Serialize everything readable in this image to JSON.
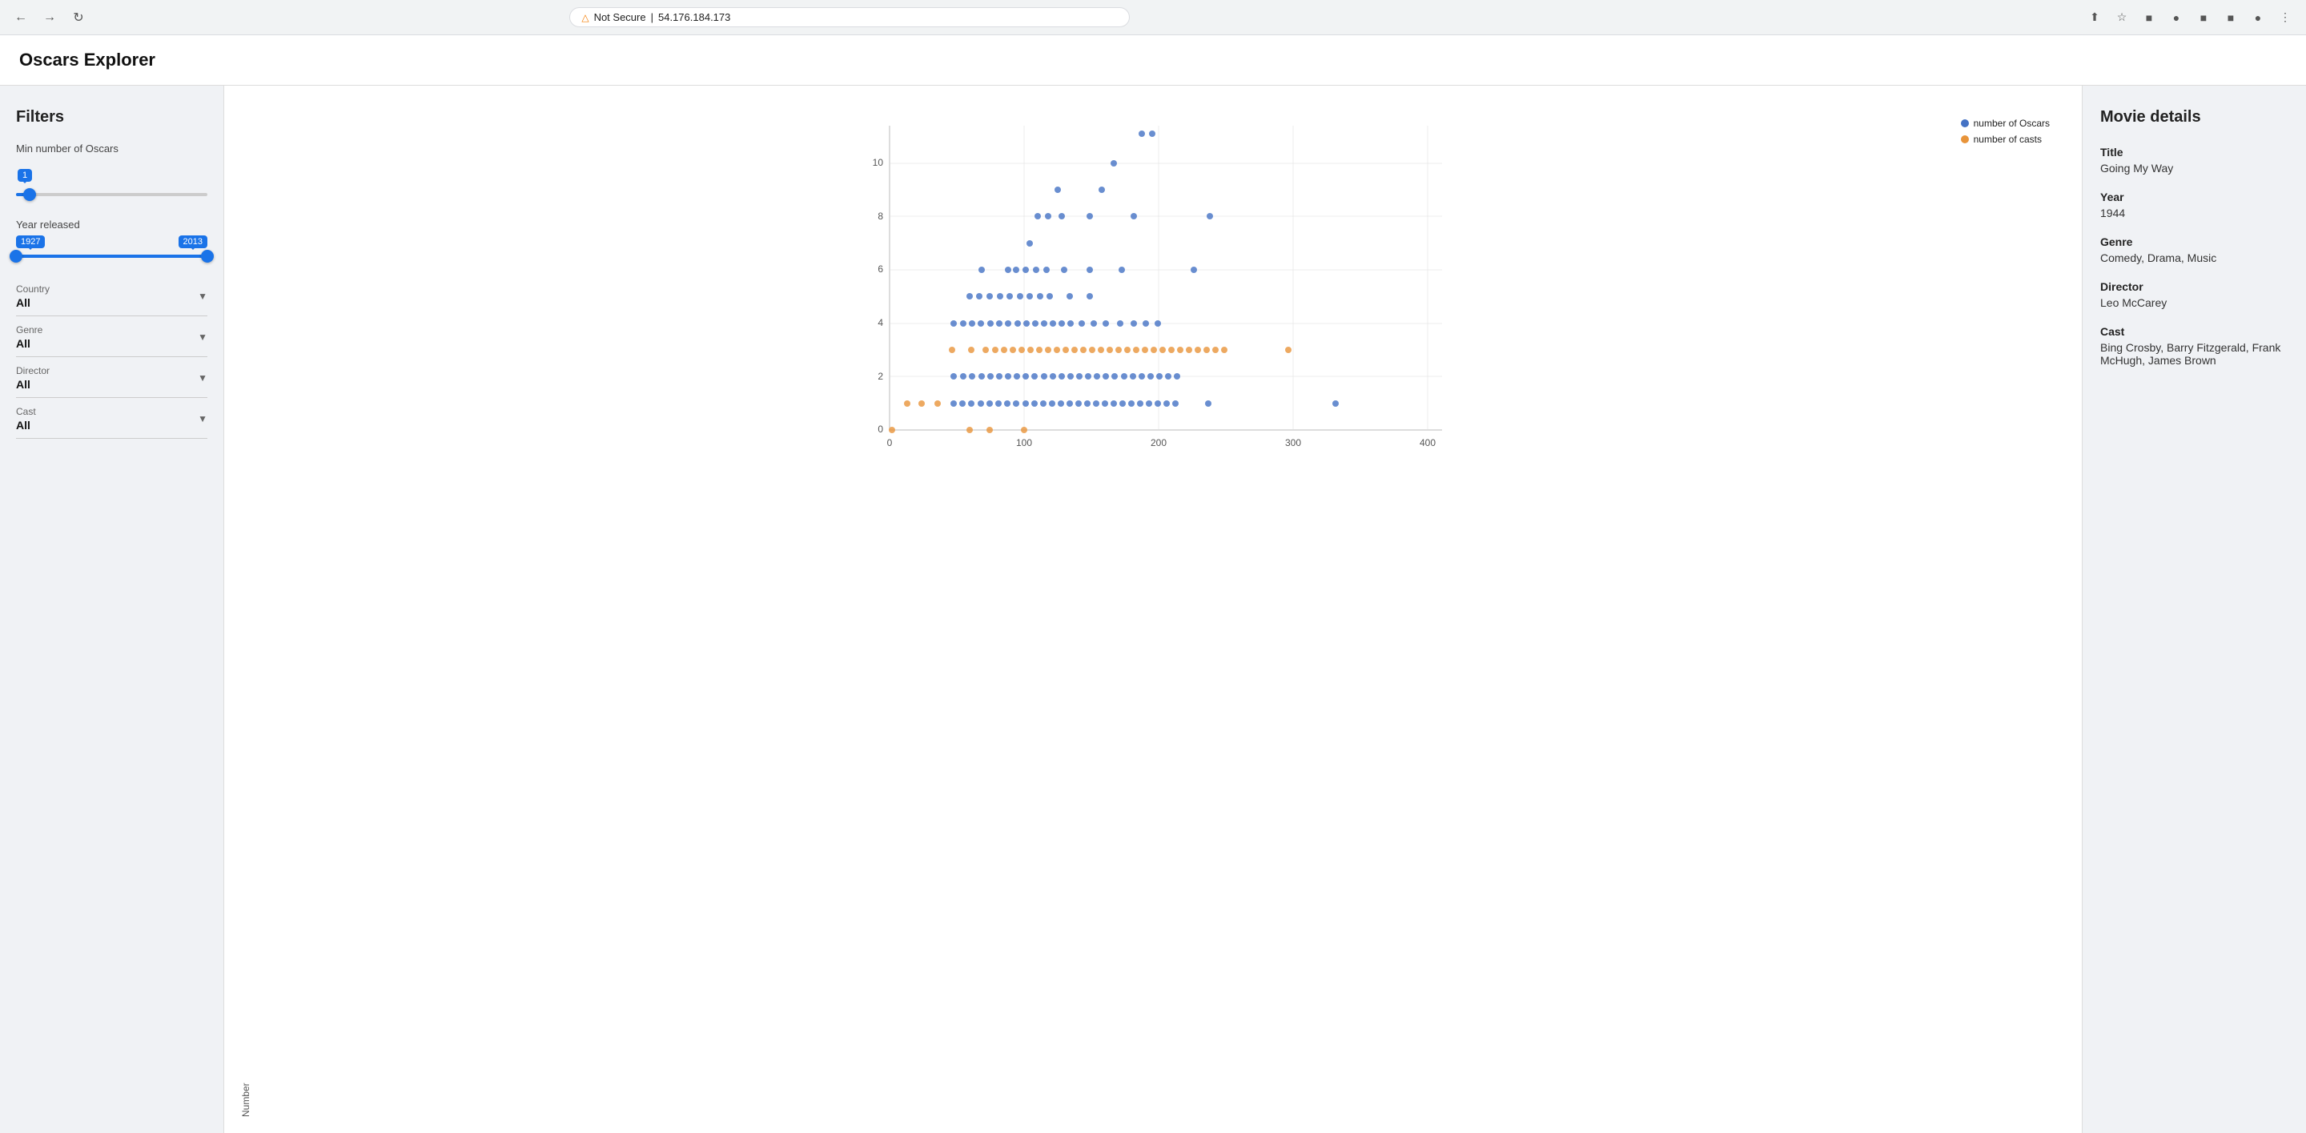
{
  "browser": {
    "url": "54.176.184.173",
    "security_label": "Not Secure"
  },
  "page": {
    "title": "Oscars Explorer"
  },
  "filters": {
    "title": "Filters",
    "min_oscars": {
      "label": "Min number of Oscars",
      "value": 1,
      "min": 0,
      "max": 14,
      "thumb_pct": 7
    },
    "year_released": {
      "label": "Year released",
      "min": 1927,
      "max": 2013,
      "left_pct": 0,
      "right_pct": 100
    },
    "country": {
      "label": "Country",
      "value": "All"
    },
    "genre": {
      "label": "Genre",
      "value": "All"
    },
    "director": {
      "label": "Director",
      "value": "All"
    },
    "cast": {
      "label": "Cast",
      "value": "All"
    }
  },
  "chart": {
    "y_axis_label": "Number",
    "x_axis_label": "",
    "legend": [
      {
        "label": "number of Oscars",
        "color": "#4472c4"
      },
      {
        "label": "number of casts",
        "color": "#e8943a"
      }
    ],
    "y_ticks": [
      0,
      2,
      4,
      6,
      8,
      10
    ],
    "x_ticks": [
      0,
      100,
      200,
      300,
      400
    ]
  },
  "movie_details": {
    "panel_title": "Movie details",
    "title_label": "Title",
    "title_value": "Going My Way",
    "year_label": "Year",
    "year_value": "1944",
    "genre_label": "Genre",
    "genre_value": "Comedy, Drama, Music",
    "director_label": "Director",
    "director_value": "Leo McCarey",
    "cast_label": "Cast",
    "cast_value": "Bing Crosby, Barry Fitzgerald, Frank McHugh, James Brown"
  }
}
